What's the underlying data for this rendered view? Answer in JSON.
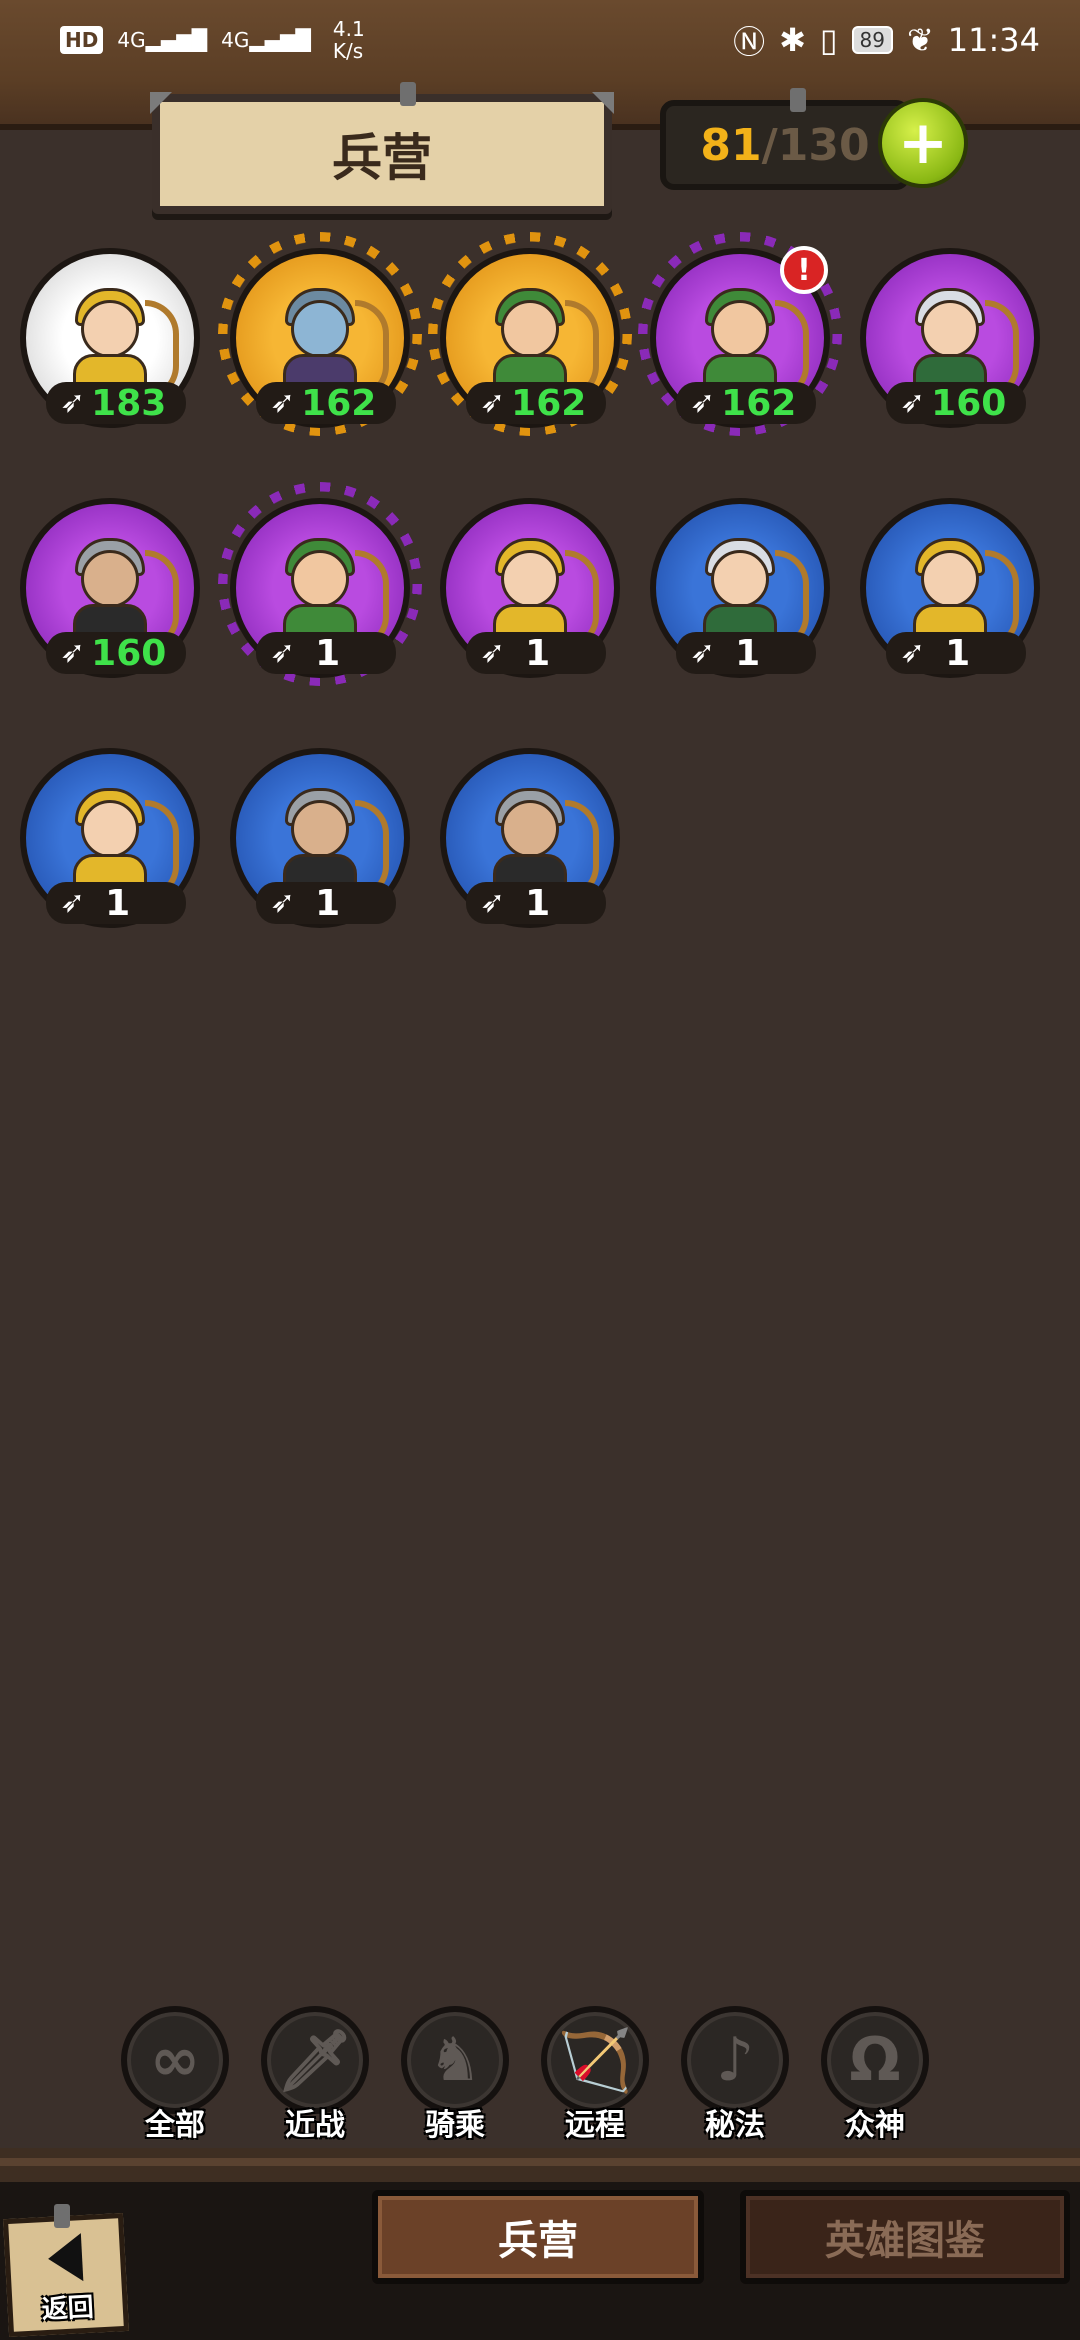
{
  "status_bar": {
    "hd": "HD",
    "signal1": "4G",
    "signal2": "4G",
    "speed": "4.1\nK/s",
    "battery": "89",
    "time": "11:34"
  },
  "header": {
    "title": "兵营",
    "capacity_current": "81",
    "capacity_separator": "/",
    "capacity_max": "130",
    "add_label": "+"
  },
  "heroes": [
    {
      "rarity": "white",
      "spiky": false,
      "char": "c-gold",
      "count": "183",
      "alert": false
    },
    {
      "rarity": "orange",
      "spiky": true,
      "char": "c-grey",
      "count": "162",
      "alert": false
    },
    {
      "rarity": "orange",
      "spiky": true,
      "char": "c-green",
      "count": "162",
      "alert": false
    },
    {
      "rarity": "purple",
      "spiky": true,
      "char": "c-green",
      "count": "162",
      "alert": true,
      "alert_text": "!"
    },
    {
      "rarity": "purple",
      "spiky": false,
      "char": "c-elf",
      "count": "160",
      "alert": false
    },
    {
      "rarity": "purple",
      "spiky": false,
      "char": "c-dark",
      "count": "160",
      "alert": false
    },
    {
      "rarity": "purple",
      "spiky": true,
      "char": "c-green",
      "count": "1",
      "alert": false
    },
    {
      "rarity": "purple",
      "spiky": false,
      "char": "c-gold",
      "count": "1",
      "alert": false
    },
    {
      "rarity": "blue",
      "spiky": false,
      "char": "c-elf",
      "count": "1",
      "alert": false
    },
    {
      "rarity": "blue",
      "spiky": false,
      "char": "c-gold",
      "count": "1",
      "alert": false
    },
    {
      "rarity": "blue",
      "spiky": false,
      "char": "c-gold",
      "count": "1",
      "alert": false
    },
    {
      "rarity": "blue",
      "spiky": false,
      "char": "c-dark",
      "count": "1",
      "alert": false
    },
    {
      "rarity": "blue",
      "spiky": false,
      "char": "c-dark",
      "count": "1",
      "alert": false
    }
  ],
  "filters": [
    {
      "label": "全部",
      "icon": "∞",
      "icon_name": "infinity-icon",
      "active": false
    },
    {
      "label": "近战",
      "icon": "🗡",
      "icon_name": "sword-icon",
      "active": false
    },
    {
      "label": "骑乘",
      "icon": "♞",
      "icon_name": "horse-icon",
      "active": false
    },
    {
      "label": "远程",
      "icon": "🏹",
      "icon_name": "bow-icon",
      "active": true
    },
    {
      "label": "秘法",
      "icon": "♪",
      "icon_name": "arcane-icon",
      "active": false
    },
    {
      "label": "众神",
      "icon": "Ω",
      "icon_name": "omega-icon",
      "active": false
    }
  ],
  "bottom": {
    "back_label": "返回",
    "tab_barracks": "兵营",
    "tab_codex": "英雄图鉴"
  }
}
